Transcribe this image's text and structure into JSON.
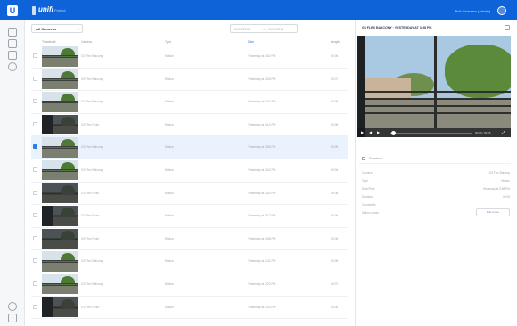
{
  "topbar": {
    "logo": "U",
    "brand": "unifi",
    "brand_sub": "Protect",
    "user_name": "Bob Guerrero (Admin)",
    "bg": "#0e63d8"
  },
  "rail": {
    "icons": [
      "live-view-icon",
      "recordings-icon",
      "devices-icon",
      "map-icon",
      "users-icon",
      "settings-icon"
    ]
  },
  "toolbar": {
    "camera_select": "All Cameras",
    "date_from": "01/11/2018",
    "date_sep": "—",
    "date_to": "01/11/2018"
  },
  "table": {
    "columns": [
      "Thumbnail",
      "Camera",
      "Type",
      "Date",
      "Length"
    ],
    "rows": [
      {
        "camera": "G3 Flex Balcony",
        "type": "Motion",
        "date": "Yesterday at 4:32 PM",
        "length": "00:05"
      },
      {
        "camera": "G3 Flex Balcony",
        "type": "Motion",
        "date": "Yesterday at 4:28 PM",
        "length": "00:07"
      },
      {
        "camera": "G3 Flex Balcony",
        "type": "Motion",
        "date": "Yesterday at 4:21 PM",
        "length": "00:05"
      },
      {
        "camera": "G3 Flex Front",
        "type": "Motion",
        "date": "Yesterday at 4:14 PM",
        "length": "00:06"
      },
      {
        "camera": "G3 Flex Balcony",
        "type": "Motion",
        "date": "Yesterday at 3:58 PM",
        "length": "00:05"
      },
      {
        "camera": "G3 Flex Balcony",
        "type": "Motion",
        "date": "Yesterday at 3:42 PM",
        "length": "00:04"
      },
      {
        "camera": "G3 Flex Front",
        "type": "Motion",
        "date": "Yesterday at 3:30 PM",
        "length": "00:08"
      },
      {
        "camera": "G3 Flex Front",
        "type": "Motion",
        "date": "Yesterday at 3:12 PM",
        "length": "00:05"
      },
      {
        "camera": "G3 Flex Front",
        "type": "Motion",
        "date": "Yesterday at 2:56 PM",
        "length": "00:06"
      },
      {
        "camera": "G3 Flex Balcony",
        "type": "Motion",
        "date": "Yesterday at 2:41 PM",
        "length": "00:05"
      },
      {
        "camera": "G3 Flex Balcony",
        "type": "Motion",
        "date": "Yesterday at 2:20 PM",
        "length": "00:07"
      },
      {
        "camera": "G3 Flex Front",
        "type": "Motion",
        "date": "Yesterday at 2:03 PM",
        "length": "00:05"
      }
    ],
    "selected_row_index": 4
  },
  "panel": {
    "title": "G3 FLEX BALCONY  ·  YESTERDAY AT 3:58 PM",
    "video_time": "00:00 / 00:05",
    "controls": [
      "play-icon",
      "rewind-icon",
      "forward-icon",
      "fullscreen-icon"
    ],
    "download_label": "Download",
    "details": [
      {
        "label": "Camera",
        "value": "G3 Flex Balcony"
      },
      {
        "label": "Type",
        "value": "Motion"
      },
      {
        "label": "Date/Time",
        "value": "Yesterday at 3:58 PM"
      },
      {
        "label": "Duration",
        "value": "00:05"
      },
      {
        "label": "Comments",
        "value": ""
      },
      {
        "label": "Motion zones",
        "value": ""
      }
    ],
    "zones_button": "Edit zones"
  }
}
